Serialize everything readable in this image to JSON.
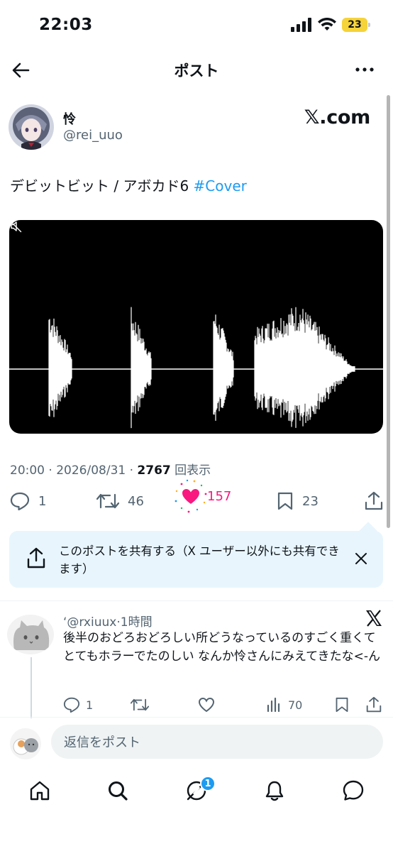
{
  "status_bar": {
    "time": "22:03",
    "battery": "23"
  },
  "header": {
    "title": "ポスト"
  },
  "post": {
    "author_name": "怜",
    "author_handle": "@rei_uuo",
    "watermark": "𝕏.com",
    "text": "デビットビット / アボカド6 ",
    "hashtag": "#Cover",
    "time": "20:00",
    "date": "2026/08/31",
    "views_count": "2767",
    "views_label": "回表示",
    "replies": "1",
    "reposts": "46",
    "likes": "157",
    "bookmarks": "23",
    "liked": true
  },
  "share_banner": {
    "text": "このポストを共有する（X ユーザー以外にも共有できます）"
  },
  "reply": {
    "handle": "‘@rxiuux",
    "time": "1時間",
    "text": "後半のおどろおどろしい所どうなっているのすごく重くてとてもホラーでたのしい なんか怜さんにみえてきたな<-ん",
    "replies": "1",
    "views": "70"
  },
  "composer": {
    "placeholder": "返信をポスト"
  },
  "tab_bar": {
    "items": [
      "home-icon",
      "search-icon",
      "grok-icon",
      "notifications-icon",
      "messages-icon"
    ],
    "grok_badge": "1"
  },
  "colors": {
    "accent": "#1d9bf0",
    "like": "#f91880",
    "muted": "#536471",
    "banner": "#e8f5fd"
  }
}
